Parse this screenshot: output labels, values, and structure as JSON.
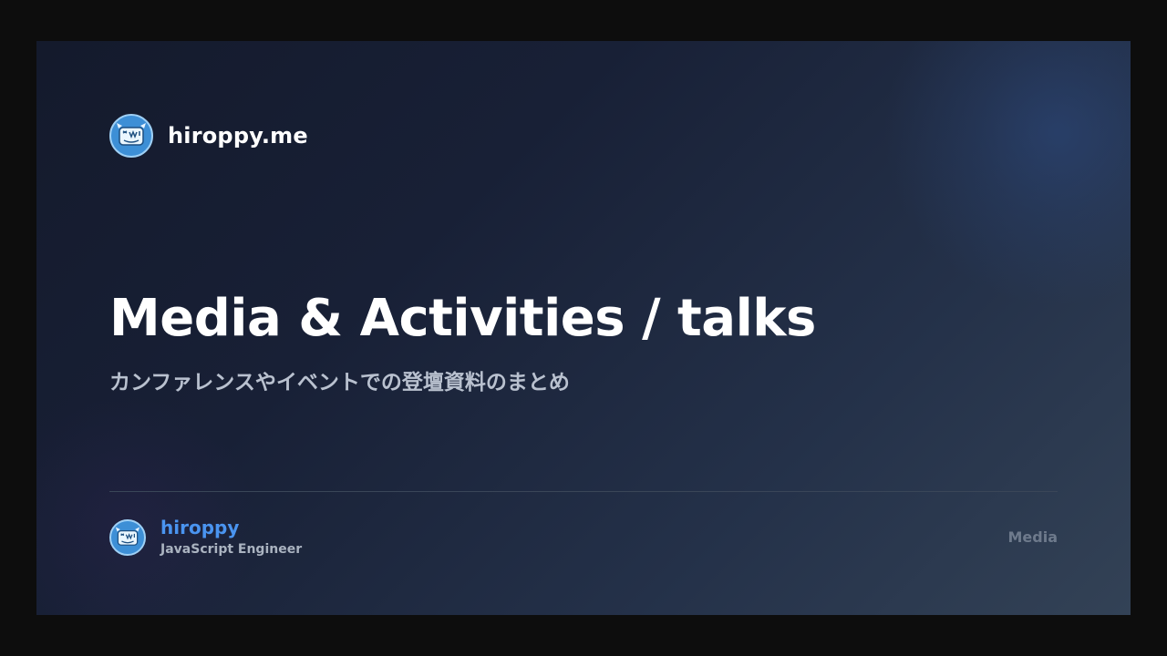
{
  "brand": {
    "name": "hiroppy.me",
    "avatar_icon": "avatar-face-icon"
  },
  "header": {
    "title": "Media & Activities / talks",
    "subtitle": "カンファレンスやイベントでの登壇資料のまとめ"
  },
  "author": {
    "name": "hiroppy",
    "role": "JavaScript Engineer",
    "avatar_icon": "avatar-face-icon"
  },
  "category": "Media",
  "colors": {
    "background_start": "#141a2c",
    "background_end": "#334256",
    "title": "#ffffff",
    "subtitle": "#b9c1cf",
    "author_name": "#4a94f0",
    "category": "#6e7a8c",
    "avatar_bg": "#3d8fd6"
  }
}
